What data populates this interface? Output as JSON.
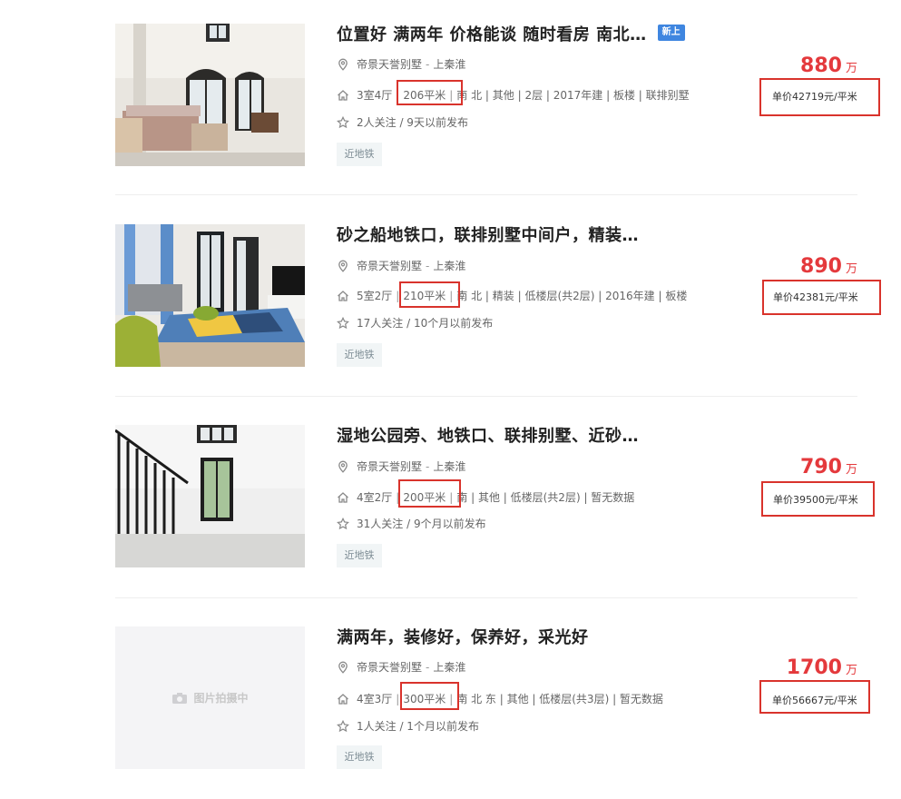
{
  "listings": [
    {
      "title": "位置好 满两年 价格能谈 随时看房 南北…",
      "badge": "新上",
      "community": "帝景天誉别墅",
      "district": "上秦淮",
      "layout": "3室4厅",
      "area": "206平米",
      "rest": "南 北 | 其他 | 2层 | 2017年建 | 板楼 | 联排别墅",
      "follow": "2人关注 / 9天以前发布",
      "tag": "近地铁",
      "price": "880",
      "price_unit": "万",
      "unit_price": "单价42719元/平米"
    },
    {
      "title": "砂之船地铁口，联排别墅中间户，精装…",
      "community": "帝景天誉别墅",
      "district": "上秦淮",
      "layout": "5室2厅",
      "area": "210平米",
      "rest": "南 北 | 精装 | 低楼层(共2层) | 2016年建 | 板楼",
      "follow": "17人关注 / 10个月以前发布",
      "tag": "近地铁",
      "price": "890",
      "price_unit": "万",
      "unit_price": "单价42381元/平米"
    },
    {
      "title": "湿地公园旁、地铁口、联排别墅、近砂…",
      "community": "帝景天誉别墅",
      "district": "上秦淮",
      "layout": "4室2厅",
      "area": "200平米",
      "rest": "南 | 其他 | 低楼层(共2层) | 暂无数据",
      "follow": "31人关注 / 9个月以前发布",
      "tag": "近地铁",
      "price": "790",
      "price_unit": "万",
      "unit_price": "单价39500元/平米"
    },
    {
      "title": "满两年，装修好，保养好，采光好",
      "community": "帝景天誉别墅",
      "district": "上秦淮",
      "layout": "4室3厅",
      "area": "300平米",
      "rest": "南 北 东 | 其他 | 低楼层(共3层) | 暂无数据",
      "follow": "1人关注 / 1个月以前发布",
      "tag": "近地铁",
      "price": "1700",
      "price_unit": "万",
      "unit_price": "单价56667元/平米",
      "placeholder": "图片拍摄中"
    }
  ],
  "icons": {
    "location": "location-pin-icon",
    "house": "house-icon",
    "star": "star-icon",
    "camera": "camera-icon"
  },
  "colors": {
    "price": "#e4393c",
    "badge": "#3f86e0",
    "highlight": "#d9332c"
  }
}
